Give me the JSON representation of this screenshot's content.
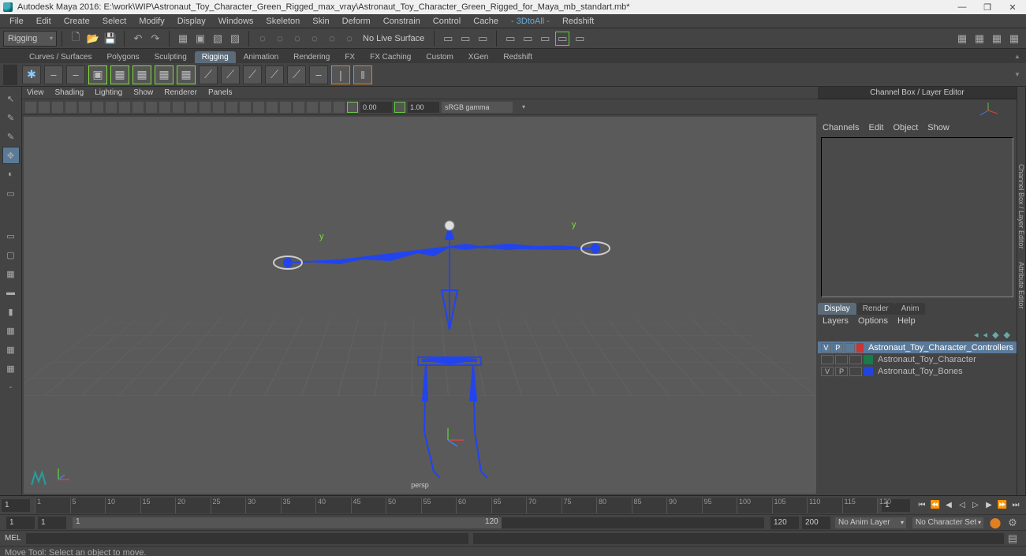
{
  "titlebar": {
    "title": "Autodesk Maya 2016: E:\\work\\WIP\\Astronaut_Toy_Character_Green_Rigged_max_vray\\Astronaut_Toy_Character_Green_Rigged_for_Maya_mb_standart.mb*"
  },
  "menubar": {
    "items": [
      "File",
      "Edit",
      "Create",
      "Select",
      "Modify",
      "Display",
      "Windows",
      "Skeleton",
      "Skin",
      "Deform",
      "Constrain",
      "Control",
      "Cache"
    ],
    "special": [
      "- 3DtoAll -",
      "Redshift"
    ]
  },
  "toolbar": {
    "workspace": "Rigging",
    "no_live_surface": "No Live Surface"
  },
  "shelf": {
    "tabs": [
      "Curves / Surfaces",
      "Polygons",
      "Sculpting",
      "Rigging",
      "Animation",
      "Rendering",
      "FX",
      "FX Caching",
      "Custom",
      "XGen",
      "Redshift"
    ],
    "active": "Rigging"
  },
  "viewport_menu": {
    "items": [
      "View",
      "Shading",
      "Lighting",
      "Show",
      "Renderer",
      "Panels"
    ],
    "num1": "0.00",
    "num2": "1.00",
    "color_mgmt": "sRGB gamma",
    "camera": "persp",
    "gizmo_y1": "y",
    "gizmo_y2": "y"
  },
  "channel_box": {
    "title": "Channel Box / Layer Editor",
    "menu": [
      "Channels",
      "Edit",
      "Object",
      "Show"
    ],
    "tabs": [
      "Display",
      "Render",
      "Anim"
    ],
    "active_tab": "Display",
    "menu2": [
      "Layers",
      "Options",
      "Help"
    ],
    "layers": [
      {
        "v": "V",
        "p": "P",
        "color": "#cc3333",
        "name": "Astronaut_Toy_Character_Controllers",
        "selected": true
      },
      {
        "v": "",
        "p": "",
        "color": "#1a7a4a",
        "name": "Astronaut_Toy_Character",
        "selected": false
      },
      {
        "v": "V",
        "p": "P",
        "color": "#2244dd",
        "name": "Astronaut_Toy_Bones",
        "selected": false
      }
    ]
  },
  "side_tabs": {
    "t1": "Channel Box / Layer Editor",
    "t2": "Attribute Editor"
  },
  "timeline": {
    "ticks": [
      1,
      5,
      10,
      15,
      20,
      25,
      30,
      35,
      40,
      45,
      50,
      55,
      60,
      65,
      70,
      75,
      80,
      85,
      90,
      95,
      100,
      105,
      110,
      115,
      120
    ],
    "current": "1",
    "range_start": "1",
    "range_inner_start": "1",
    "range_inner_end": "120",
    "range_end_a": "120",
    "range_end_b": "200",
    "anim_layer": "No Anim Layer",
    "char_set": "No Character Set"
  },
  "cmd": {
    "label": "MEL"
  },
  "status": {
    "text": "Move Tool: Select an object to move."
  }
}
